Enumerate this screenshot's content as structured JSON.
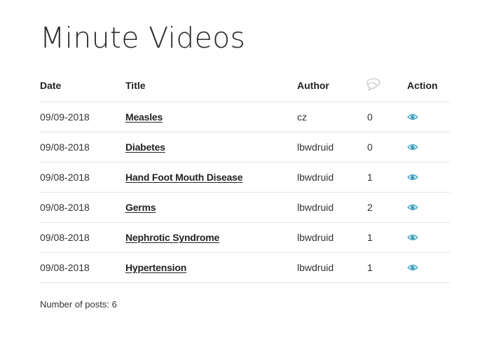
{
  "page": {
    "title": "Minute Videos"
  },
  "table": {
    "headers": {
      "date": "Date",
      "title": "Title",
      "author": "Author",
      "comments_icon": "comments-icon",
      "action": "Action"
    },
    "rows": [
      {
        "date": "09/09-2018",
        "title": "Measles",
        "author": "cz",
        "comments": "0",
        "action_icon": "eye-icon"
      },
      {
        "date": "09/08-2018",
        "title": "Diabetes",
        "author": "lbwdruid",
        "comments": "0",
        "action_icon": "eye-icon"
      },
      {
        "date": "09/08-2018",
        "title": "Hand Foot Mouth Disease",
        "author": "lbwdruid",
        "comments": "1",
        "action_icon": "eye-icon"
      },
      {
        "date": "09/08-2018",
        "title": "Germs",
        "author": "lbwdruid",
        "comments": "2",
        "action_icon": "eye-icon"
      },
      {
        "date": "09/08-2018",
        "title": "Nephrotic Syndrome",
        "author": "lbwdruid",
        "comments": "1",
        "action_icon": "eye-icon"
      },
      {
        "date": "09/08-2018",
        "title": "Hypertension",
        "author": "lbwdruid",
        "comments": "1",
        "action_icon": "eye-icon"
      }
    ]
  },
  "footer": {
    "post_count": "Number of posts: 6"
  },
  "colors": {
    "eye_icon": "#1f8fae",
    "divider": "#e3e3e3",
    "comment_icon": "#c8c8c8"
  }
}
